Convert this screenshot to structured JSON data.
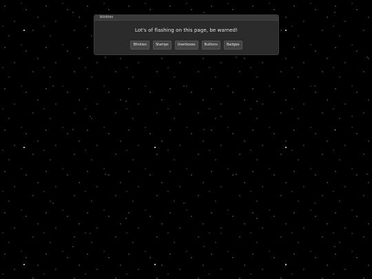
{
  "window": {
    "title": "blinkies"
  },
  "dialog": {
    "message": "Lot's of flashing on this page, be warned!"
  },
  "buttons": [
    {
      "label": "Blinkies"
    },
    {
      "label": "Stamps"
    },
    {
      "label": "Userboxes"
    },
    {
      "label": "Buttons"
    },
    {
      "label": "Badges"
    }
  ],
  "colors": {
    "background": "#000000",
    "dialog": "#2a2a2a",
    "titlebar": "#3a3a3a",
    "button": "#444444",
    "text": "#e6e6e6"
  }
}
